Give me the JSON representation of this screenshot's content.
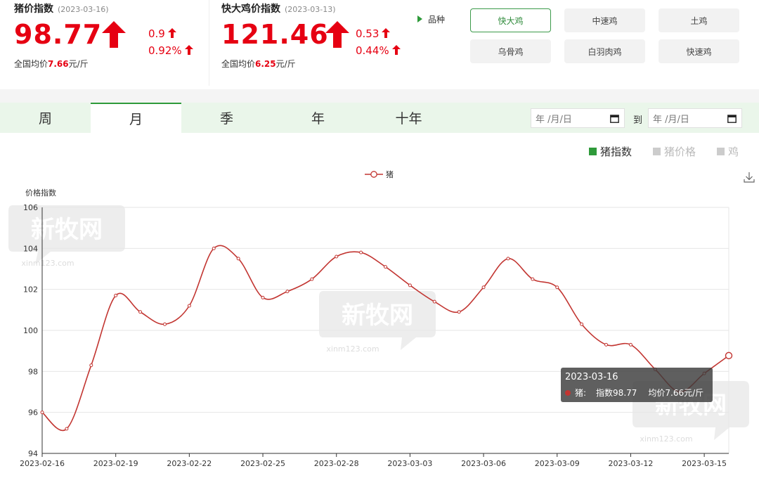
{
  "pig_index": {
    "title": "猪价指数",
    "date": "(2023-03-16)",
    "value": "98.77",
    "change": "0.9",
    "change_pct": "0.92%",
    "avg_prefix": "全国均价",
    "avg_value": "7.66",
    "avg_unit": "元/斤"
  },
  "chicken_index": {
    "title": "快大鸡价指数",
    "date": "(2023-03-13)",
    "value": "121.46",
    "change": "0.53",
    "change_pct": "0.44%",
    "avg_prefix": "全国均价",
    "avg_value": "6.25",
    "avg_unit": "元/斤"
  },
  "variety": {
    "label": "品种",
    "options": [
      "快大鸡",
      "中速鸡",
      "土鸡",
      "乌骨鸡",
      "白羽肉鸡",
      "快速鸡"
    ],
    "selected": "快大鸡"
  },
  "tabs": [
    "周",
    "月",
    "季",
    "年",
    "十年"
  ],
  "active_tab": "月",
  "date_range": {
    "start_placeholder": "年 /月/日",
    "end_placeholder": "年 /月/日",
    "to_label": "到"
  },
  "metric_toggles": [
    {
      "label": "猪指数",
      "active": true
    },
    {
      "label": "猪价格",
      "active": false
    },
    {
      "label": "鸡",
      "active": false
    }
  ],
  "watermark": {
    "brand": "新牧网",
    "site": "xinm123.com"
  },
  "tooltip": {
    "date": "2023-03-16",
    "series": "猪:",
    "index_text": "指数98.77",
    "avg_text": "均价7.66元/斤"
  },
  "colors": {
    "accent_red": "#e60012",
    "line": "#c23531",
    "brand_green": "#2e9a3a",
    "tab_bg": "#eaf6ea"
  },
  "chart_data": {
    "type": "line",
    "ylabel": "价格指数",
    "ylim": [
      94,
      106
    ],
    "yticks": [
      94,
      96,
      98,
      100,
      102,
      104,
      106
    ],
    "xtick_labels": [
      "2023-02-16",
      "2023-02-19",
      "2023-02-22",
      "2023-02-25",
      "2023-02-28",
      "2023-03-03",
      "2023-03-06",
      "2023-03-09",
      "2023-03-12",
      "2023-03-15"
    ],
    "grid": true,
    "legend_position": "top-center",
    "series": [
      {
        "name": "猪",
        "x": [
          "2023-02-16",
          "2023-02-17",
          "2023-02-18",
          "2023-02-19",
          "2023-02-20",
          "2023-02-21",
          "2023-02-22",
          "2023-02-23",
          "2023-02-24",
          "2023-02-25",
          "2023-02-26",
          "2023-02-27",
          "2023-02-28",
          "2023-03-01",
          "2023-03-02",
          "2023-03-03",
          "2023-03-04",
          "2023-03-05",
          "2023-03-06",
          "2023-03-07",
          "2023-03-08",
          "2023-03-09",
          "2023-03-10",
          "2023-03-11",
          "2023-03-12",
          "2023-03-13",
          "2023-03-14",
          "2023-03-15",
          "2023-03-16"
        ],
        "values": [
          96.0,
          95.2,
          98.3,
          101.7,
          100.9,
          100.3,
          101.2,
          104.0,
          103.5,
          101.6,
          101.9,
          102.5,
          103.6,
          103.8,
          103.1,
          102.2,
          101.4,
          100.9,
          102.1,
          103.5,
          102.5,
          102.1,
          100.3,
          99.3,
          99.3,
          98.1,
          97.0,
          97.9,
          98.77
        ]
      }
    ]
  }
}
